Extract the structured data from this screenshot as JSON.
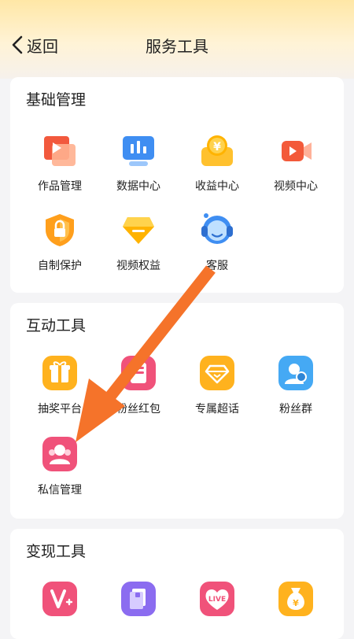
{
  "header": {
    "back_label": "返回",
    "title": "服务工具"
  },
  "sections": [
    {
      "title": "基础管理",
      "items": [
        {
          "label": "作品管理",
          "icon": "works-folder-icon"
        },
        {
          "label": "数据中心",
          "icon": "data-chart-icon"
        },
        {
          "label": "收益中心",
          "icon": "income-coin-icon"
        },
        {
          "label": "视频中心",
          "icon": "video-camera-icon"
        },
        {
          "label": "自制保护",
          "icon": "shield-lock-icon"
        },
        {
          "label": "视频权益",
          "icon": "diamond-badge-icon"
        },
        {
          "label": "客服",
          "icon": "headset-icon"
        }
      ]
    },
    {
      "title": "互动工具",
      "items": [
        {
          "label": "抽奖平台",
          "icon": "gift-box-icon"
        },
        {
          "label": "粉丝红包",
          "icon": "red-envelope-icon"
        },
        {
          "label": "专属超话",
          "icon": "gem-icon"
        },
        {
          "label": "粉丝群",
          "icon": "fan-group-icon"
        },
        {
          "label": "私信管理",
          "icon": "private-message-icon"
        }
      ]
    },
    {
      "title": "变现工具",
      "items": [
        {
          "label": "",
          "icon": "v-plus-icon"
        },
        {
          "label": "",
          "icon": "purple-document-icon"
        },
        {
          "label": "",
          "icon": "live-badge-icon"
        },
        {
          "label": "",
          "icon": "money-bag-icon"
        }
      ]
    }
  ],
  "annotation": {
    "icon": "orange-arrow-icon",
    "color": "#f5732a"
  }
}
